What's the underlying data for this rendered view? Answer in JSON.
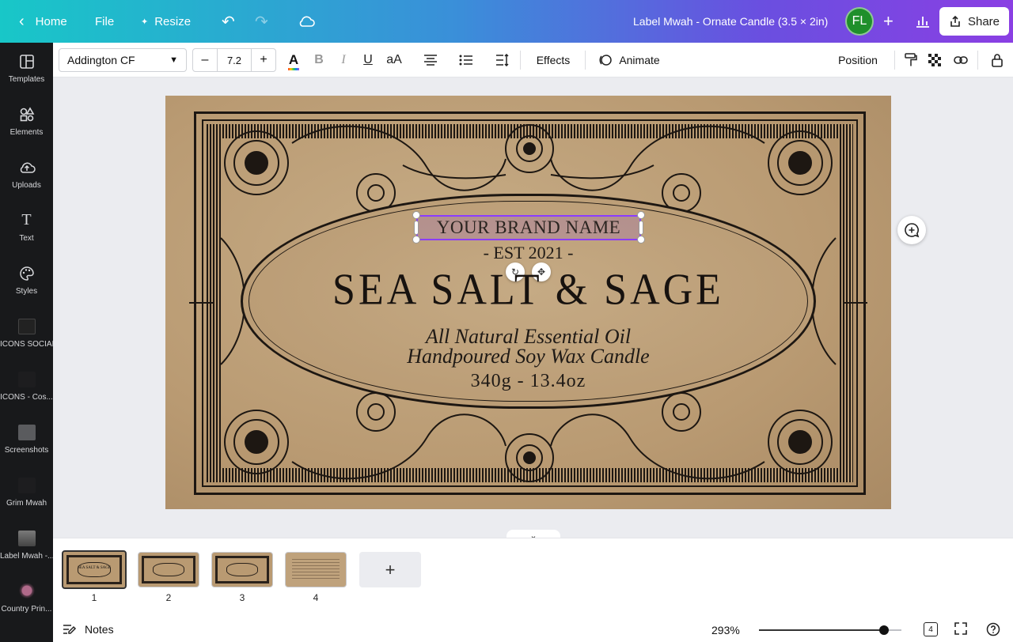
{
  "topbar": {
    "home_label": "Home",
    "file_label": "File",
    "resize_label": "Resize",
    "doc_title": "Label Mwah - Ornate Candle (3.5 × 2in)",
    "avatar_initials": "FL",
    "share_label": "Share"
  },
  "sidebar": {
    "items": [
      {
        "label": "Templates"
      },
      {
        "label": "Elements"
      },
      {
        "label": "Uploads"
      },
      {
        "label": "Text"
      },
      {
        "label": "Styles"
      },
      {
        "label": "ICONS SOCIAL"
      },
      {
        "label": "ICONS - Cos..."
      },
      {
        "label": "Screenshots"
      },
      {
        "label": "Grim Mwah"
      },
      {
        "label": "Label Mwah -..."
      },
      {
        "label": "Country Prin..."
      }
    ]
  },
  "toolbar": {
    "font_family": "Addington CF",
    "font_size": "7.2",
    "minus": "–",
    "plus": "+",
    "effects_label": "Effects",
    "animate_label": "Animate",
    "position_label": "Position",
    "case_label": "aA"
  },
  "canvas": {
    "brand": "YOUR BRAND NAME",
    "est": "- EST 2021 -",
    "title": "SEA SALT & SAGE",
    "line1": "All Natural Essential Oil",
    "line2": "Handpoured Soy Wax Candle",
    "weight": "340g - 13.4oz",
    "bg_color": "#b99a72",
    "ink_color": "#1d1712"
  },
  "pages": [
    {
      "number": "1",
      "thumb_text": "SEA SALT & SAGE",
      "active": true
    },
    {
      "number": "2",
      "thumb_text": "",
      "active": false
    },
    {
      "number": "3",
      "thumb_text": "",
      "active": false
    },
    {
      "number": "4",
      "thumb_text": "",
      "active": false
    }
  ],
  "bottombar": {
    "notes_label": "Notes",
    "zoom": "293%",
    "zoom_fraction": 0.88,
    "page_count": "4"
  },
  "colors": {
    "accent": "#8b3dff",
    "sidebar_bg": "#18191b",
    "avatar_bg": "#1f8f2b"
  }
}
